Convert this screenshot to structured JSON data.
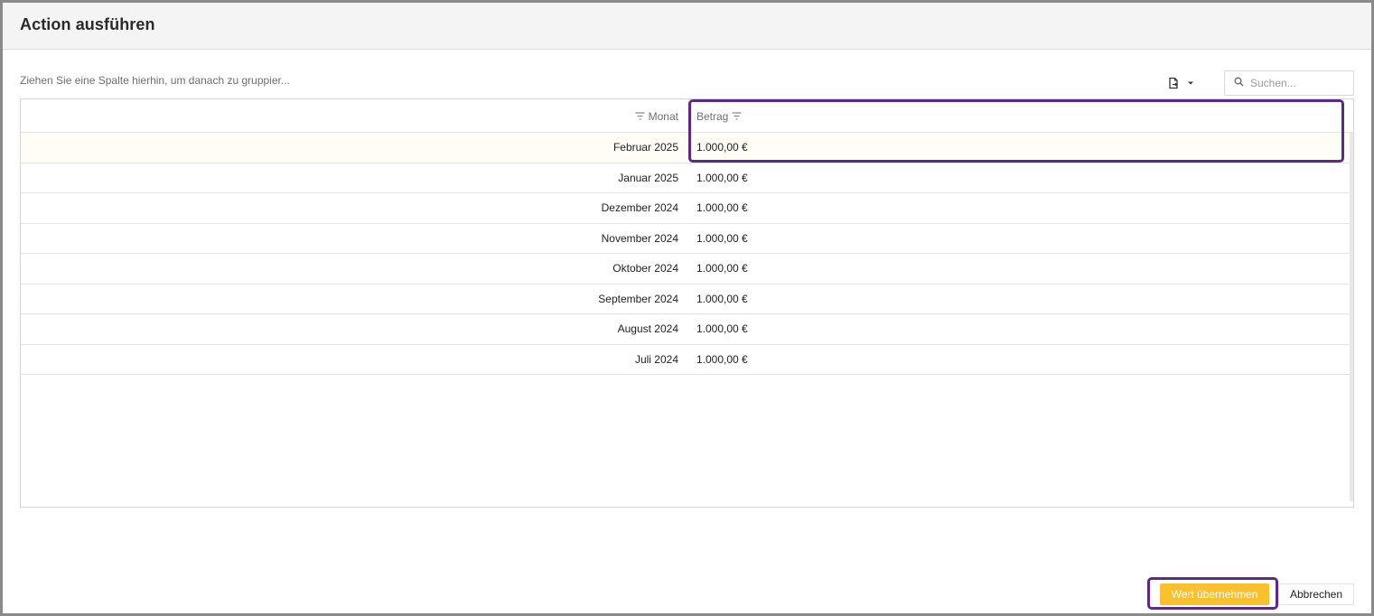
{
  "dialog": {
    "title": "Action ausführen"
  },
  "toolbar": {
    "group_hint": "Ziehen Sie eine Spalte hierhin, um danach zu gruppier...",
    "export_icon": "export-document-icon",
    "search": {
      "placeholder": "Suchen...",
      "value": ""
    }
  },
  "grid": {
    "columns": [
      {
        "label": "Monat"
      },
      {
        "label": "Betrag"
      }
    ],
    "rows": [
      {
        "monat": "Februar 2025",
        "betrag": "1.000,00 €",
        "selected": true
      },
      {
        "monat": "Januar 2025",
        "betrag": "1.000,00 €"
      },
      {
        "monat": "Dezember 2024",
        "betrag": "1.000,00 €"
      },
      {
        "monat": "November 2024",
        "betrag": "1.000,00 €"
      },
      {
        "monat": "Oktober 2024",
        "betrag": "1.000,00 €"
      },
      {
        "monat": "September 2024",
        "betrag": "1.000,00 €"
      },
      {
        "monat": "August 2024",
        "betrag": "1.000,00 €"
      },
      {
        "monat": "Juli 2024",
        "betrag": "1.000,00 €"
      }
    ]
  },
  "footer": {
    "apply_label": "Wert übernehmen",
    "cancel_label": "Abbrechen"
  },
  "colors": {
    "accent": "#fbc02d",
    "highlight": "#5c2a86",
    "selected_row": "#fffdf5"
  }
}
